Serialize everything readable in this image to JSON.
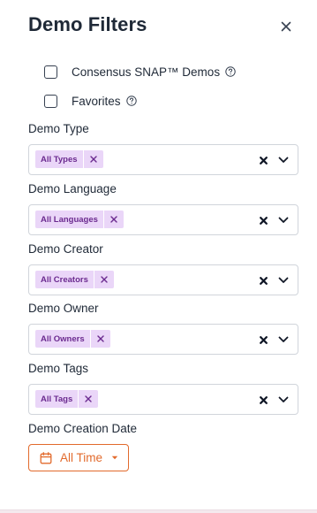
{
  "panel": {
    "title": "Demo Filters"
  },
  "checkboxes": [
    {
      "label": "Consensus SNAP™ Demos",
      "checked": false,
      "has_help": true
    },
    {
      "label": "Favorites",
      "checked": false,
      "has_help": true
    }
  ],
  "filters": [
    {
      "label": "Demo Type",
      "chip": "All Types"
    },
    {
      "label": "Demo Language",
      "chip": "All Languages"
    },
    {
      "label": "Demo Creator",
      "chip": "All Creators"
    },
    {
      "label": "Demo Owner",
      "chip": "All Owners"
    },
    {
      "label": "Demo Tags",
      "chip": "All Tags"
    }
  ],
  "date_filter": {
    "label": "Demo Creation Date",
    "value": "All Time"
  },
  "icons": {
    "close": "close-icon",
    "help": "question-circle-icon",
    "chip_remove": "x-icon",
    "clear": "clear-x-icon",
    "dropdown": "chevron-down-icon",
    "calendar": "calendar-icon",
    "caret": "caret-down-icon"
  },
  "colors": {
    "chip_bg": "#ead6f8",
    "chip_text": "#6b2a8f",
    "accent_orange": "#e26a2c",
    "text": "#1f2937",
    "border": "#d1d5db"
  }
}
